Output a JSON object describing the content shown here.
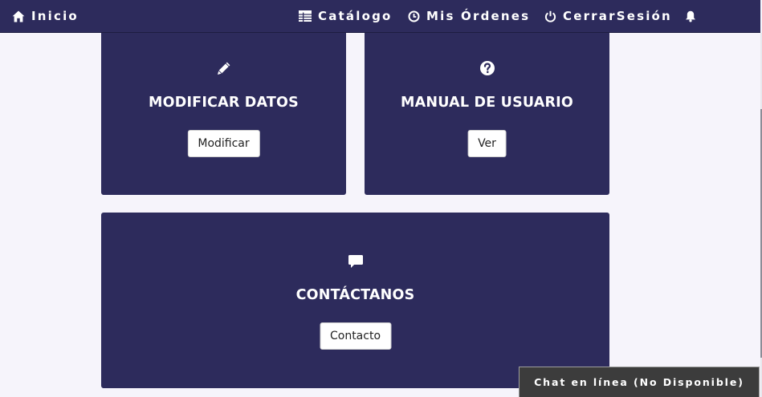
{
  "nav": {
    "home_label": "Inicio",
    "catalog_label": "Catálogo",
    "orders_label": "Mis Órdenes",
    "logout_label": "CerrarSesión",
    "icons": [
      "home-icon",
      "table-icon",
      "clock-icon",
      "power-icon",
      "bell-icon"
    ]
  },
  "cards": [
    {
      "icon": "pencil-icon",
      "title": "MODIFICAR DATOS",
      "button": "Modificar"
    },
    {
      "icon": "question-circle-icon",
      "title": "MANUAL DE USUARIO",
      "button": "Ver"
    },
    {
      "icon": "comment-icon",
      "title": "CONTÁCTANOS",
      "button": "Contacto"
    }
  ],
  "chat": {
    "label": "Chat en línea (No Disponible)"
  },
  "colors": {
    "navbar": "#2d2b5c",
    "card": "#2d2b5c",
    "page_background": "#f6f4fb",
    "chat_tab": "#3c3c3c",
    "button": "#ffffff"
  }
}
